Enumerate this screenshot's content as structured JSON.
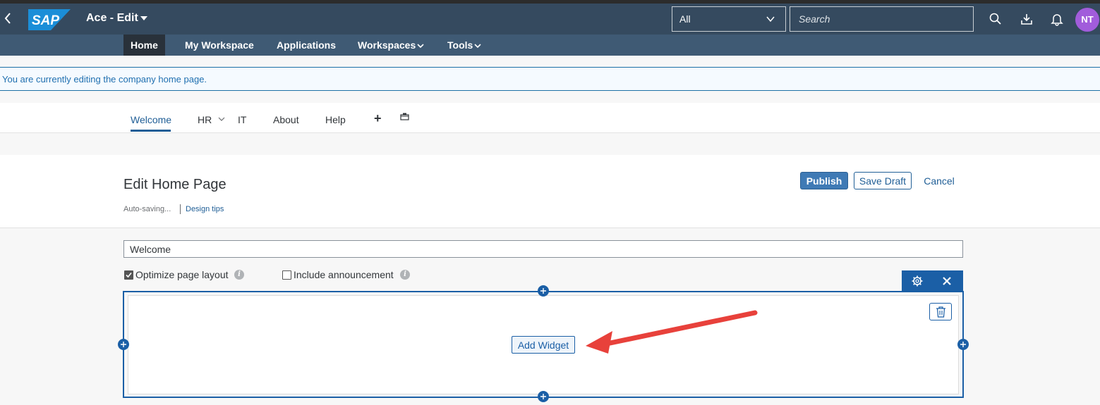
{
  "shell": {
    "app_title": "Ace - Edit",
    "logo_text": "SAP",
    "scope_value": "All",
    "search_placeholder": "Search",
    "user_initials": "NT"
  },
  "nav": {
    "items": [
      {
        "label": "Home",
        "active": true
      },
      {
        "label": "My Workspace"
      },
      {
        "label": "Applications"
      },
      {
        "label": "Workspaces",
        "has_menu": true
      },
      {
        "label": "Tools",
        "has_menu": true
      }
    ]
  },
  "info_message": "You are currently editing the company home page.",
  "page_tabs": {
    "items": [
      {
        "label": "Welcome",
        "active": true
      },
      {
        "label": "HR",
        "has_menu": true
      },
      {
        "label": "IT"
      },
      {
        "label": "About"
      },
      {
        "label": "Help"
      }
    ],
    "add_label": "+"
  },
  "editor": {
    "title": "Edit Home Page",
    "autosave_status": "Auto-saving...",
    "design_tips_link": "Design tips",
    "publish_label": "Publish",
    "save_draft_label": "Save Draft",
    "cancel_label": "Cancel",
    "page_name_value": "Welcome",
    "optimize_layout_label": "Optimize page layout",
    "optimize_layout_checked": true,
    "include_announcement_label": "Include announcement",
    "include_announcement_checked": false,
    "info_glyph": "i",
    "add_widget_label": "Add Widget"
  },
  "colors": {
    "shell_bg": "#354a5f",
    "nav_bg": "#3f5a74",
    "accent": "#1b5fa6",
    "annotation_arrow": "#e8413b",
    "avatar_bg": "#a15cdb"
  }
}
